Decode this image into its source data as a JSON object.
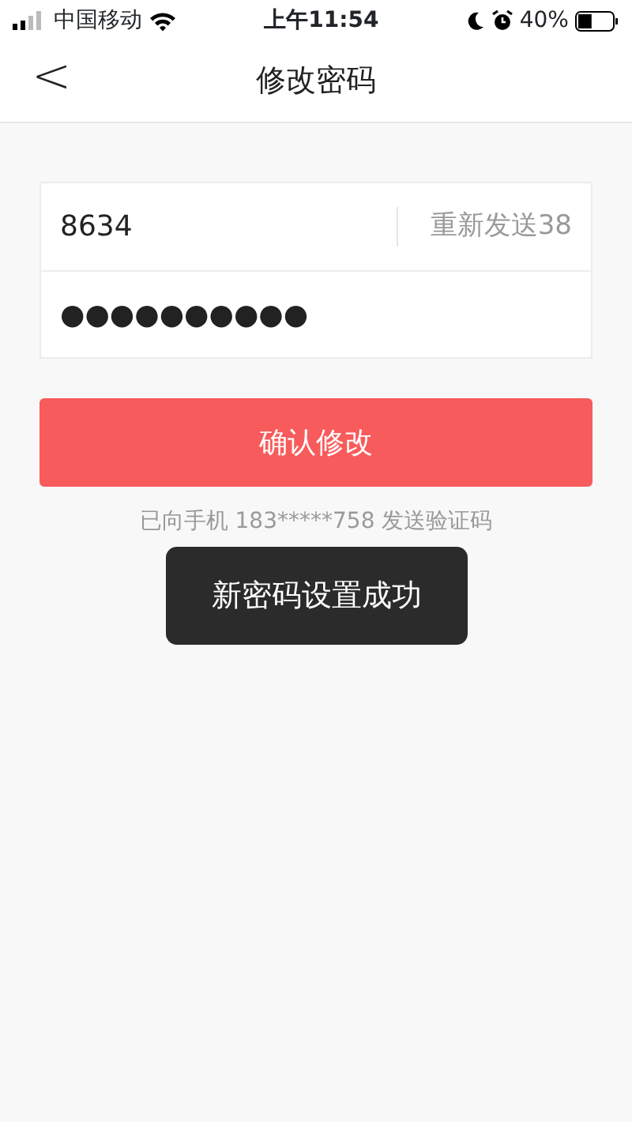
{
  "status_bar": {
    "carrier": "中国移动",
    "time": "上午11:54",
    "battery": "40%"
  },
  "nav": {
    "back": "<",
    "title": "修改密码"
  },
  "form": {
    "code_value": "8634",
    "resend": "重新发送38",
    "password_value": "●●●●●●●●●●"
  },
  "submit": "确认修改",
  "hint": "已向手机 183*****758 发送验证码",
  "toast": "新密码设置成功"
}
